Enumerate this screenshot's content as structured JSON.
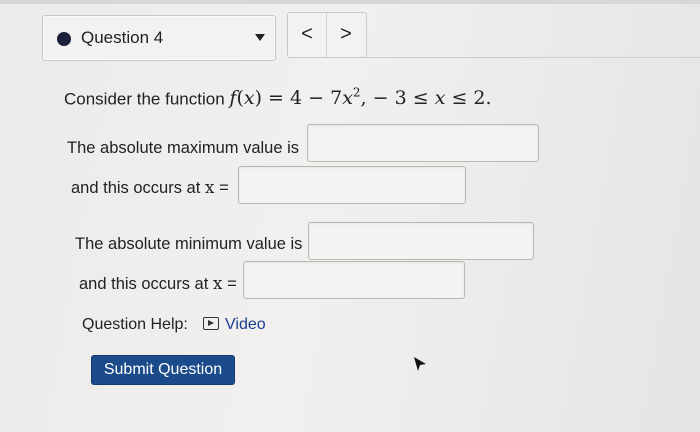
{
  "question": {
    "selector_label": "Question 4",
    "prev_symbol": "<",
    "next_symbol": ">"
  },
  "problem": {
    "prefix": "Consider the function ",
    "f": "f",
    "x": "x",
    "formula_rest": " = 4 − 7",
    "exp": "2",
    "domain_lhs": ",   − 3 ≤ ",
    "domain_rhs": " ≤ 2."
  },
  "rows": {
    "abs_max_label": "The absolute maximum value is",
    "abs_max_x_label": "and this occurs at ",
    "abs_min_label": "The absolute minimum value is",
    "abs_min_x_label": "and this occurs at ",
    "x_var": "x",
    "equals": " ="
  },
  "inputs": {
    "abs_max_value": "",
    "abs_max_x": "",
    "abs_min_value": "",
    "abs_min_x": ""
  },
  "help": {
    "label": "Question Help:",
    "video_label": "Video"
  },
  "submit_label": "Submit Question",
  "icons": {
    "selector_dot": "filled-circle-icon",
    "selector_caret": "caret-down-icon",
    "video": "play-box-icon",
    "cursor": "mouse-cursor-icon"
  }
}
